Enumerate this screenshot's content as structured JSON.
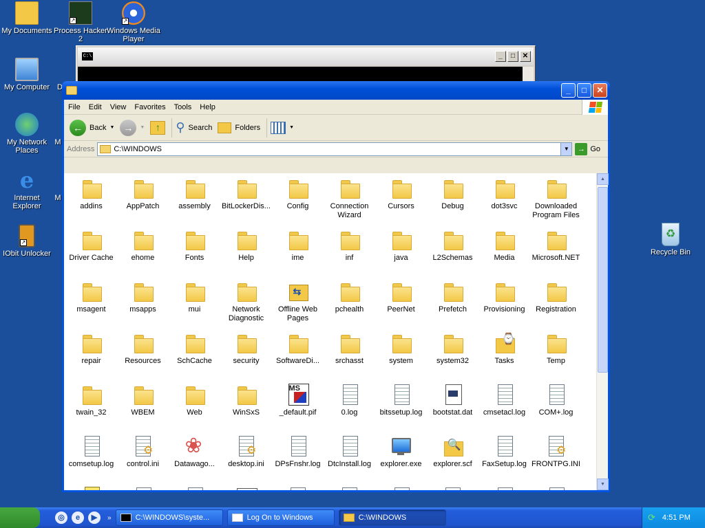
{
  "desktop": {
    "icons": [
      {
        "label": "My Documents",
        "icon": "folder-documents-icon"
      },
      {
        "label": "Process Hacker 2",
        "icon": "process-hacker-icon"
      },
      {
        "label": "Windows Media Player",
        "icon": "media-player-icon"
      },
      {
        "label": "My Computer",
        "icon": "computer-icon"
      },
      {
        "label": "D",
        "icon": "partial-icon"
      },
      {
        "label": "My Network Places",
        "icon": "network-icon"
      },
      {
        "label": "M",
        "icon": "partial-icon"
      },
      {
        "label": "Internet Explorer",
        "icon": "ie-icon"
      },
      {
        "label": "M",
        "icon": "partial-icon"
      },
      {
        "label": "IObit Unlocker",
        "icon": "unlocker-icon"
      },
      {
        "label": "Recycle Bin",
        "icon": "recycle-bin-icon"
      }
    ]
  },
  "console": {
    "icon_text": "C:\\"
  },
  "explorer": {
    "menu": [
      "File",
      "Edit",
      "View",
      "Favorites",
      "Tools",
      "Help"
    ],
    "toolbar": {
      "back": "Back",
      "search": "Search",
      "folders": "Folders"
    },
    "address": {
      "label": "Address",
      "value": "C:\\WINDOWS",
      "go": "Go"
    },
    "items": [
      {
        "name": "addins",
        "type": "folder"
      },
      {
        "name": "AppPatch",
        "type": "folder"
      },
      {
        "name": "assembly",
        "type": "folder"
      },
      {
        "name": "BitLockerDis...",
        "type": "folder"
      },
      {
        "name": "Config",
        "type": "folder"
      },
      {
        "name": "Connection Wizard",
        "type": "folder"
      },
      {
        "name": "Cursors",
        "type": "folder"
      },
      {
        "name": "Debug",
        "type": "folder"
      },
      {
        "name": "dot3svc",
        "type": "folder"
      },
      {
        "name": "Downloaded Program Files",
        "type": "folder"
      },
      {
        "name": "Driver Cache",
        "type": "folder"
      },
      {
        "name": "ehome",
        "type": "folder"
      },
      {
        "name": "Fonts",
        "type": "folder"
      },
      {
        "name": "Help",
        "type": "folder"
      },
      {
        "name": "ime",
        "type": "folder"
      },
      {
        "name": "inf",
        "type": "folder"
      },
      {
        "name": "java",
        "type": "folder"
      },
      {
        "name": "L2Schemas",
        "type": "folder"
      },
      {
        "name": "Media",
        "type": "folder"
      },
      {
        "name": "Microsoft.NET",
        "type": "folder"
      },
      {
        "name": "msagent",
        "type": "folder"
      },
      {
        "name": "msapps",
        "type": "folder"
      },
      {
        "name": "mui",
        "type": "folder"
      },
      {
        "name": "Network Diagnostic",
        "type": "folder"
      },
      {
        "name": "Offline Web Pages",
        "type": "web"
      },
      {
        "name": "pchealth",
        "type": "folder"
      },
      {
        "name": "PeerNet",
        "type": "folder"
      },
      {
        "name": "Prefetch",
        "type": "folder"
      },
      {
        "name": "Provisioning",
        "type": "folder"
      },
      {
        "name": "Registration",
        "type": "folder"
      },
      {
        "name": "repair",
        "type": "folder"
      },
      {
        "name": "Resources",
        "type": "folder"
      },
      {
        "name": "SchCache",
        "type": "folder"
      },
      {
        "name": "security",
        "type": "folder"
      },
      {
        "name": "SoftwareDi...",
        "type": "folder"
      },
      {
        "name": "srchasst",
        "type": "folder"
      },
      {
        "name": "system",
        "type": "folder"
      },
      {
        "name": "system32",
        "type": "folder"
      },
      {
        "name": "Tasks",
        "type": "tasks"
      },
      {
        "name": "Temp",
        "type": "folder"
      },
      {
        "name": "twain_32",
        "type": "folder"
      },
      {
        "name": "WBEM",
        "type": "folder"
      },
      {
        "name": "Web",
        "type": "folder"
      },
      {
        "name": "WinSxS",
        "type": "folder"
      },
      {
        "name": "_default.pif",
        "type": "pif"
      },
      {
        "name": "0.log",
        "type": "file"
      },
      {
        "name": "bitssetup.log",
        "type": "file"
      },
      {
        "name": "bootstat.dat",
        "type": "dat"
      },
      {
        "name": "cmsetacl.log",
        "type": "file"
      },
      {
        "name": "COM+.log",
        "type": "file"
      },
      {
        "name": "comsetup.log",
        "type": "file"
      },
      {
        "name": "control.ini",
        "type": "gear"
      },
      {
        "name": "Datawago...",
        "type": "web2"
      },
      {
        "name": "desktop.ini",
        "type": "gear"
      },
      {
        "name": "DPsFnshr.log",
        "type": "file"
      },
      {
        "name": "DtcInstall.log",
        "type": "file"
      },
      {
        "name": "explorer.exe",
        "type": "exe"
      },
      {
        "name": "explorer.scf",
        "type": "scf"
      },
      {
        "name": "FaxSetup.log",
        "type": "file"
      },
      {
        "name": "FRONTPG.INI",
        "type": "gear"
      },
      {
        "name": "",
        "type": "help"
      },
      {
        "name": "",
        "type": "file"
      },
      {
        "name": "",
        "type": "file"
      },
      {
        "name": "",
        "type": "win"
      },
      {
        "name": "",
        "type": "gear"
      },
      {
        "name": "",
        "type": "gear"
      },
      {
        "name": "",
        "type": "file"
      },
      {
        "name": "",
        "type": "gear"
      },
      {
        "name": "",
        "type": "file"
      },
      {
        "name": "",
        "type": "file"
      }
    ]
  },
  "taskbar": {
    "tasks": [
      {
        "label": "C:\\WINDOWS\\syste...",
        "icon": "console-icon",
        "active": false
      },
      {
        "label": "Log On to Windows",
        "icon": "window-icon",
        "active": false
      },
      {
        "label": "C:\\WINDOWS",
        "icon": "folder-icon",
        "active": true
      }
    ],
    "clock": "4:51 PM"
  }
}
